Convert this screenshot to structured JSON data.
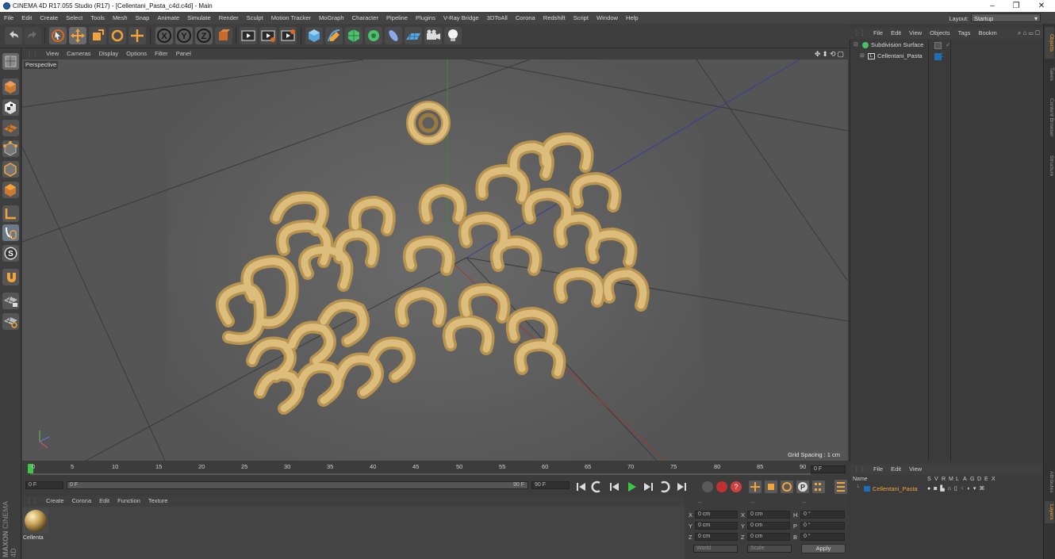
{
  "window": {
    "title": "CINEMA 4D R17.055 Studio (R17) - [Cellentani_Pasta_c4d.c4d] - Main",
    "controls": [
      "–",
      "❐",
      "✕"
    ]
  },
  "menu": [
    "File",
    "Edit",
    "Create",
    "Select",
    "Tools",
    "Mesh",
    "Snap",
    "Animate",
    "Simulate",
    "Render",
    "Sculpt",
    "Motion Tracker",
    "MoGraph",
    "Character",
    "Pipeline",
    "Plugins",
    "V-Ray Bridge",
    "3DToAll",
    "Corona",
    "Redshift",
    "Script",
    "Window",
    "Help"
  ],
  "layout": {
    "label": "Layout:",
    "value": "Startup"
  },
  "viewport": {
    "menu": [
      "View",
      "Cameras",
      "Display",
      "Options",
      "Filter",
      "Panel"
    ],
    "camera_label": "Perspective",
    "grid_spacing": "Grid Spacing : 1 cm",
    "nav_icons": [
      "✥",
      "⬍",
      "⟲",
      "▢"
    ]
  },
  "timeline": {
    "ticks": [
      "0",
      "5",
      "10",
      "15",
      "20",
      "25",
      "30",
      "35",
      "40",
      "45",
      "50",
      "55",
      "60",
      "65",
      "70",
      "75",
      "80",
      "85",
      "90"
    ],
    "current_frame_field": "0 F",
    "start_field": "0 F",
    "slider_start": "0 F",
    "slider_end": "90 F",
    "end_field": "90 F"
  },
  "material_panel": {
    "menu": [
      "Create",
      "Corona",
      "Edit",
      "Function",
      "Texture"
    ],
    "material_name": "Cellenta"
  },
  "coordinates": {
    "header": [
      "--",
      "--",
      "--"
    ],
    "rows": [
      {
        "a": "X",
        "av": "0 cm",
        "b": "X",
        "bv": "0 cm",
        "c": "H",
        "cv": "0 °"
      },
      {
        "a": "Y",
        "av": "0 cm",
        "b": "Y",
        "bv": "0 cm",
        "c": "P",
        "cv": "0 °"
      },
      {
        "a": "Z",
        "av": "0 cm",
        "b": "Z",
        "bv": "0 cm",
        "c": "B",
        "cv": "0 °"
      }
    ],
    "mode": "World",
    "scale": "Scale",
    "apply": "Apply"
  },
  "objects_panel": {
    "menu": [
      "File",
      "Edit",
      "View",
      "Objects",
      "Tags",
      "Bookm"
    ],
    "items": [
      "Subdivision Surface",
      "Cellentani_Pasta"
    ]
  },
  "layers_panel": {
    "menu": [
      "File",
      "Edit",
      "View"
    ],
    "name_header": "Name",
    "col_headers": [
      "S",
      "V",
      "R",
      "M",
      "L",
      "A",
      "G",
      "D",
      "E",
      "X"
    ],
    "items": [
      "Cellentani_Pasta"
    ]
  },
  "side_tabs": [
    "Objects",
    "Takes",
    "Content Browser",
    "Structure",
    "Attributes",
    "Layers"
  ],
  "brand": {
    "line1": "MAXON",
    "line2": "CINEMA 4D"
  },
  "colors": {
    "accent": "#f2a33a",
    "pasta": "#d8b878",
    "viewport_bg": "#555555"
  }
}
